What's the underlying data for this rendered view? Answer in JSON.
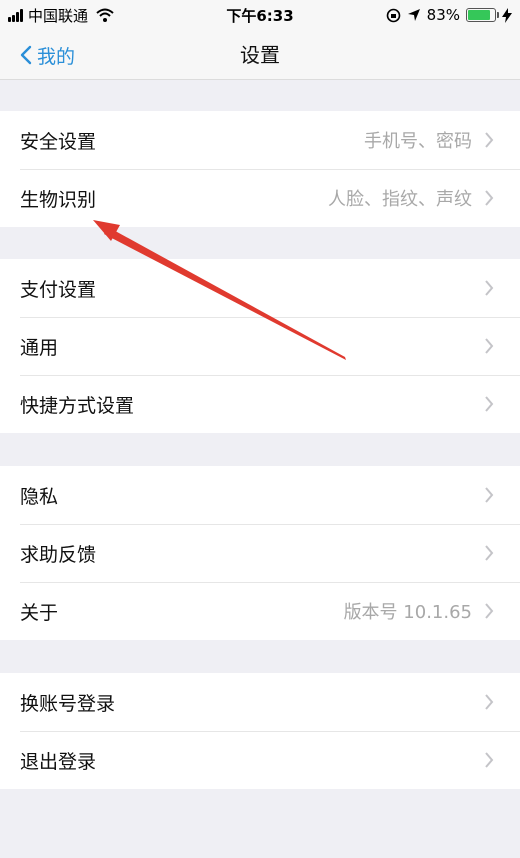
{
  "status_bar": {
    "carrier": "中国联通",
    "time": "下午6:33",
    "battery": "83%",
    "battery_level": 0.83
  },
  "nav": {
    "back_label": "我的",
    "title": "设置"
  },
  "groups": [
    {
      "items": [
        {
          "label": "安全设置",
          "value": "手机号、密码"
        },
        {
          "label": "生物识别",
          "value": "人脸、指纹、声纹"
        }
      ]
    },
    {
      "items": [
        {
          "label": "支付设置",
          "value": ""
        },
        {
          "label": "通用",
          "value": ""
        },
        {
          "label": "快捷方式设置",
          "value": ""
        }
      ]
    },
    {
      "items": [
        {
          "label": "隐私",
          "value": ""
        },
        {
          "label": "求助反馈",
          "value": ""
        },
        {
          "label": "关于",
          "value": "版本号 10.1.65"
        }
      ]
    },
    {
      "items": [
        {
          "label": "换账号登录",
          "value": ""
        },
        {
          "label": "退出登录",
          "value": ""
        }
      ]
    }
  ],
  "colors": {
    "accent": "#2a8fd8",
    "annotation": "#e03a2f",
    "battery": "#35c759"
  },
  "icons": {
    "back": "chevron-left-icon",
    "row_disclosure": "chevron-right-icon"
  }
}
